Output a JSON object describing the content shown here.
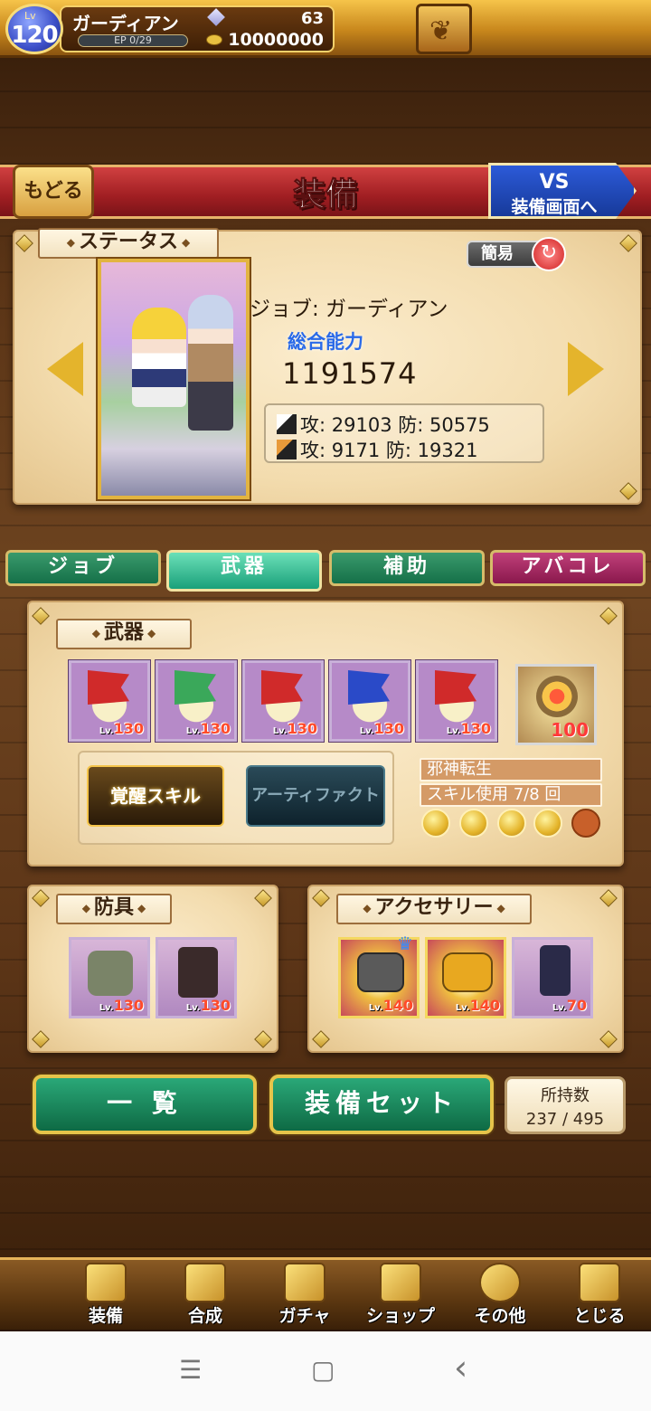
{
  "player": {
    "level_label": "Lv",
    "level": "120",
    "name": "ガーディアン",
    "ep": "EP 0/29",
    "gems": "63",
    "coins": "10000000"
  },
  "header": {
    "back_label": "もどる",
    "title": "装備",
    "vs_line1": "VS",
    "vs_line2": "装備画面へ"
  },
  "status": {
    "tag": "ステータス",
    "simple_label": "簡易",
    "job_line": "ジョブ: ガーディアン",
    "total_label": "総合能力",
    "total_value": "1191574",
    "phys": "攻: 29103 防: 50575",
    "magic": "攻: 9171 防: 19321"
  },
  "tabs": [
    "ジョブ",
    "武器",
    "補助",
    "アバコレ"
  ],
  "weapons": {
    "tag": "武器",
    "items": [
      {
        "level": "130",
        "color": "#d02a2a"
      },
      {
        "level": "130",
        "color": "#3aa85a"
      },
      {
        "level": "130",
        "color": "#d02a2a"
      },
      {
        "level": "130",
        "color": "#2a4ac8"
      },
      {
        "level": "130",
        "color": "#d02a2a"
      }
    ],
    "artifact_level": "100",
    "wake_label": "覚醒スキル",
    "artifact_label": "アーティファクト",
    "skill_name": "邪神転生",
    "skill_use": "スキル使用 7/8 回",
    "lv_prefix": "Lv."
  },
  "armor": {
    "tag": "防具",
    "items": [
      {
        "level": "130"
      },
      {
        "level": "130"
      }
    ]
  },
  "accessory": {
    "tag": "アクセサリー",
    "items": [
      {
        "level": "140"
      },
      {
        "level": "140"
      },
      {
        "level": "70"
      }
    ]
  },
  "actions": {
    "list_label": "一 覧",
    "set_label": "装備セット",
    "count_label": "所持数",
    "count_value": "237 / 495"
  },
  "nav": [
    "装備",
    "合成",
    "ガチャ",
    "ショップ",
    "その他",
    "とじる"
  ],
  "sys": {
    "menu": "☰",
    "home": "▢",
    "back": "‹"
  }
}
